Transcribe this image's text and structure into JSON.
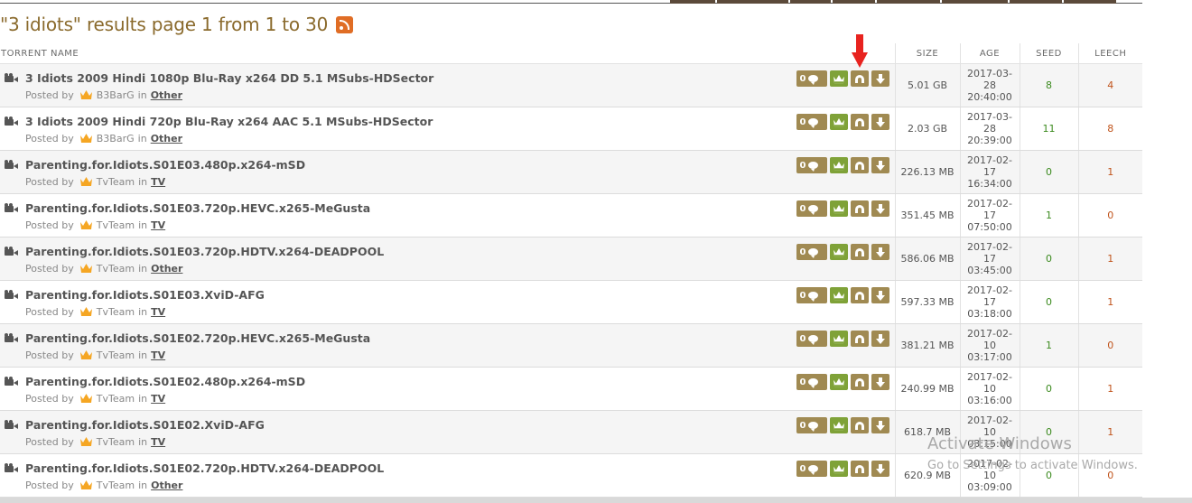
{
  "header": {
    "title": "\"3 idiots\" results page 1 from 1 to 30",
    "rss_icon": "rss-icon"
  },
  "columns": {
    "name": "TORRENT NAME",
    "size": "SIZE",
    "age": "AGE",
    "seed": "SEED",
    "leech": "LEECH"
  },
  "labels": {
    "posted_by": "Posted by",
    "in": "in"
  },
  "rows": [
    {
      "name": "3 Idiots 2009 Hindi 1080p Blu-Ray x264 DD 5.1 MSubs-HDSector",
      "user": "B3BarG",
      "category": "Other",
      "comments": "0",
      "size": "5.01 GB",
      "age1": "2017-03-",
      "age2": "28",
      "age3": "20:40:00",
      "seed": "8",
      "leech": "4"
    },
    {
      "name": "3 Idiots 2009 Hindi 720p Blu-Ray x264 AAC 5.1 MSubs-HDSector",
      "user": "B3BarG",
      "category": "Other",
      "comments": "0",
      "size": "2.03 GB",
      "age1": "2017-03-",
      "age2": "28",
      "age3": "20:39:00",
      "seed": "11",
      "leech": "8"
    },
    {
      "name": "Parenting.for.Idiots.S01E03.480p.x264-mSD",
      "user": "TvTeam",
      "category": "TV",
      "comments": "0",
      "size": "226.13 MB",
      "age1": "2017-02-",
      "age2": "17",
      "age3": "16:34:00",
      "seed": "0",
      "leech": "1"
    },
    {
      "name": "Parenting.for.Idiots.S01E03.720p.HEVC.x265-MeGusta",
      "user": "TvTeam",
      "category": "TV",
      "comments": "0",
      "size": "351.45 MB",
      "age1": "2017-02-",
      "age2": "17",
      "age3": "07:50:00",
      "seed": "1",
      "leech": "0"
    },
    {
      "name": "Parenting.for.Idiots.S01E03.720p.HDTV.x264-DEADPOOL",
      "user": "TvTeam",
      "category": "Other",
      "comments": "0",
      "size": "586.06 MB",
      "age1": "2017-02-",
      "age2": "17",
      "age3": "03:45:00",
      "seed": "0",
      "leech": "1"
    },
    {
      "name": "Parenting.for.Idiots.S01E03.XviD-AFG",
      "user": "TvTeam",
      "category": "TV",
      "comments": "0",
      "size": "597.33 MB",
      "age1": "2017-02-",
      "age2": "17",
      "age3": "03:18:00",
      "seed": "0",
      "leech": "1"
    },
    {
      "name": "Parenting.for.Idiots.S01E02.720p.HEVC.x265-MeGusta",
      "user": "TvTeam",
      "category": "TV",
      "comments": "0",
      "size": "381.21 MB",
      "age1": "2017-02-",
      "age2": "10",
      "age3": "03:17:00",
      "seed": "1",
      "leech": "0"
    },
    {
      "name": "Parenting.for.Idiots.S01E02.480p.x264-mSD",
      "user": "TvTeam",
      "category": "TV",
      "comments": "0",
      "size": "240.99 MB",
      "age1": "2017-02-",
      "age2": "10",
      "age3": "03:16:00",
      "seed": "0",
      "leech": "1"
    },
    {
      "name": "Parenting.for.Idiots.S01E02.XviD-AFG",
      "user": "TvTeam",
      "category": "TV",
      "comments": "0",
      "size": "618.7 MB",
      "age1": "2017-02-",
      "age2": "10",
      "age3": "03:15:00",
      "seed": "0",
      "leech": "1"
    },
    {
      "name": "Parenting.for.Idiots.S01E02.720p.HDTV.x264-DEADPOOL",
      "user": "TvTeam",
      "category": "Other",
      "comments": "0",
      "size": "620.9 MB",
      "age1": "2017-02-",
      "age2": "10",
      "age3": "03:09:00",
      "seed": "0",
      "leech": "0"
    }
  ],
  "watermark": {
    "line1": "Activate Windows",
    "line2": "Go to Settings to activate Windows."
  },
  "colors": {
    "title": "#8a6a2c",
    "seed": "#3b8a1e",
    "leech": "#c0531b",
    "button_brown": "#a08a52",
    "button_green": "#7fa238",
    "annotation_arrow": "#e8231f"
  }
}
